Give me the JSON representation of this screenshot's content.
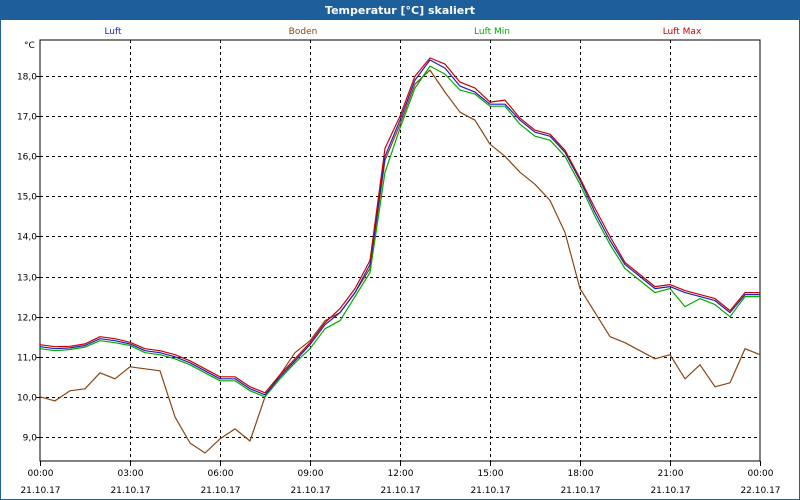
{
  "window": {
    "title": "Temperatur [°C] skaliert"
  },
  "chart_data": {
    "type": "line",
    "title": "Temperatur [°C] skaliert",
    "ylabel": "°C",
    "xlabel": "",
    "ylim": [
      8.4,
      18.9
    ],
    "yticks": [
      9.0,
      10.0,
      11.0,
      12.0,
      13.0,
      14.0,
      15.0,
      16.0,
      17.0,
      18.0
    ],
    "ytick_labels": [
      "9,0",
      "10,0",
      "11,0",
      "12,0",
      "13,0",
      "14,0",
      "15,0",
      "16,0",
      "17,0",
      "18,0"
    ],
    "xlim": [
      0,
      24
    ],
    "xticks": [
      0,
      3,
      6,
      9,
      12,
      15,
      18,
      21,
      24
    ],
    "xtick_time_labels": [
      "00:00",
      "03:00",
      "06:00",
      "09:00",
      "12:00",
      "15:00",
      "18:00",
      "21:00",
      "00:00"
    ],
    "xtick_date_labels": [
      "21.10.17",
      "21.10.17",
      "21.10.17",
      "21.10.17",
      "21.10.17",
      "21.10.17",
      "21.10.17",
      "21.10.17",
      "22.10.17"
    ],
    "grid": true,
    "legend_position": "top",
    "series": [
      {
        "name": "Luft",
        "color": "#1f1fc0",
        "x": [
          0,
          0.5,
          1,
          1.5,
          2,
          2.5,
          3,
          3.5,
          4,
          4.5,
          5,
          5.5,
          6,
          6.5,
          7,
          7.5,
          8,
          8.5,
          9,
          9.5,
          10,
          10.5,
          11,
          11.5,
          12,
          12.5,
          13,
          13.5,
          14,
          14.5,
          15,
          15.5,
          16,
          16.5,
          17,
          17.5,
          18,
          18.5,
          19,
          19.5,
          20,
          20.5,
          21,
          21.5,
          22,
          22.5,
          23,
          23.5,
          24
        ],
        "values": [
          11.25,
          11.2,
          11.22,
          11.28,
          11.45,
          11.4,
          11.32,
          11.15,
          11.1,
          11.0,
          10.85,
          10.65,
          10.45,
          10.45,
          10.2,
          10.05,
          10.5,
          10.9,
          11.3,
          11.8,
          12.1,
          12.6,
          13.3,
          16.0,
          16.9,
          17.9,
          18.4,
          18.2,
          17.75,
          17.6,
          17.3,
          17.3,
          16.9,
          16.6,
          16.5,
          16.1,
          15.4,
          14.6,
          13.9,
          13.3,
          13.0,
          12.7,
          12.75,
          12.6,
          12.5,
          12.4,
          12.1,
          12.55,
          12.55
        ]
      },
      {
        "name": "Boden",
        "color": "#8b4513",
        "x": [
          0,
          0.5,
          1,
          1.5,
          2,
          2.5,
          3,
          3.5,
          4,
          4.5,
          5,
          5.5,
          6,
          6.5,
          7,
          7.5,
          8,
          8.5,
          9,
          9.5,
          10,
          10.5,
          11,
          11.5,
          12,
          12.5,
          13,
          13.5,
          14,
          14.5,
          15,
          15.5,
          16,
          16.5,
          17,
          17.5,
          18,
          18.5,
          19,
          19.5,
          20,
          20.5,
          21,
          21.5,
          22,
          22.5,
          23,
          23.5,
          24
        ],
        "values": [
          10.0,
          9.9,
          10.15,
          10.2,
          10.6,
          10.45,
          10.75,
          10.7,
          10.65,
          9.5,
          8.85,
          8.6,
          8.95,
          9.2,
          8.9,
          10.0,
          10.55,
          11.1,
          11.4,
          11.9,
          12.1,
          12.6,
          13.2,
          15.9,
          16.8,
          17.8,
          18.15,
          17.6,
          17.1,
          16.9,
          16.3,
          16.0,
          15.6,
          15.3,
          14.9,
          14.1,
          12.7,
          12.1,
          11.5,
          11.35,
          11.15,
          10.95,
          11.05,
          10.45,
          10.8,
          10.25,
          10.35,
          11.2,
          11.05
        ]
      },
      {
        "name": "Luft Min",
        "color": "#00aa00",
        "x": [
          0,
          0.5,
          1,
          1.5,
          2,
          2.5,
          3,
          3.5,
          4,
          4.5,
          5,
          5.5,
          6,
          6.5,
          7,
          7.5,
          8,
          8.5,
          9,
          9.5,
          10,
          10.5,
          11,
          11.5,
          12,
          12.5,
          13,
          13.5,
          14,
          14.5,
          15,
          15.5,
          16,
          16.5,
          17,
          17.5,
          18,
          18.5,
          19,
          19.5,
          20,
          20.5,
          21,
          21.5,
          22,
          22.5,
          23,
          23.5,
          24
        ],
        "values": [
          11.2,
          11.15,
          11.18,
          11.24,
          11.4,
          11.35,
          11.28,
          11.1,
          11.05,
          10.95,
          10.8,
          10.6,
          10.4,
          10.4,
          10.15,
          10.0,
          10.45,
          10.85,
          11.2,
          11.7,
          11.9,
          12.5,
          13.1,
          15.6,
          16.7,
          17.7,
          18.25,
          18.05,
          17.65,
          17.55,
          17.25,
          17.25,
          16.8,
          16.5,
          16.4,
          16.0,
          15.3,
          14.5,
          13.8,
          13.2,
          12.9,
          12.6,
          12.7,
          12.25,
          12.45,
          12.3,
          12.0,
          12.5,
          12.5
        ]
      },
      {
        "name": "Luft Max",
        "color": "#cc0000",
        "x": [
          0,
          0.5,
          1,
          1.5,
          2,
          2.5,
          3,
          3.5,
          4,
          4.5,
          5,
          5.5,
          6,
          6.5,
          7,
          7.5,
          8,
          8.5,
          9,
          9.5,
          10,
          10.5,
          11,
          11.5,
          12,
          12.5,
          13,
          13.5,
          14,
          14.5,
          15,
          15.5,
          16,
          16.5,
          17,
          17.5,
          18,
          18.5,
          19,
          19.5,
          20,
          20.5,
          21,
          21.5,
          22,
          22.5,
          23,
          23.5,
          24
        ],
        "values": [
          11.3,
          11.25,
          11.26,
          11.32,
          11.5,
          11.45,
          11.36,
          11.2,
          11.15,
          11.05,
          10.9,
          10.7,
          10.5,
          10.5,
          10.25,
          10.1,
          10.55,
          10.95,
          11.35,
          11.85,
          12.2,
          12.7,
          13.4,
          16.2,
          17.0,
          18.0,
          18.45,
          18.3,
          17.85,
          17.7,
          17.35,
          17.4,
          16.95,
          16.65,
          16.55,
          16.15,
          15.45,
          14.7,
          14.0,
          13.35,
          13.05,
          12.75,
          12.8,
          12.65,
          12.55,
          12.45,
          12.15,
          12.6,
          12.6
        ]
      }
    ]
  }
}
